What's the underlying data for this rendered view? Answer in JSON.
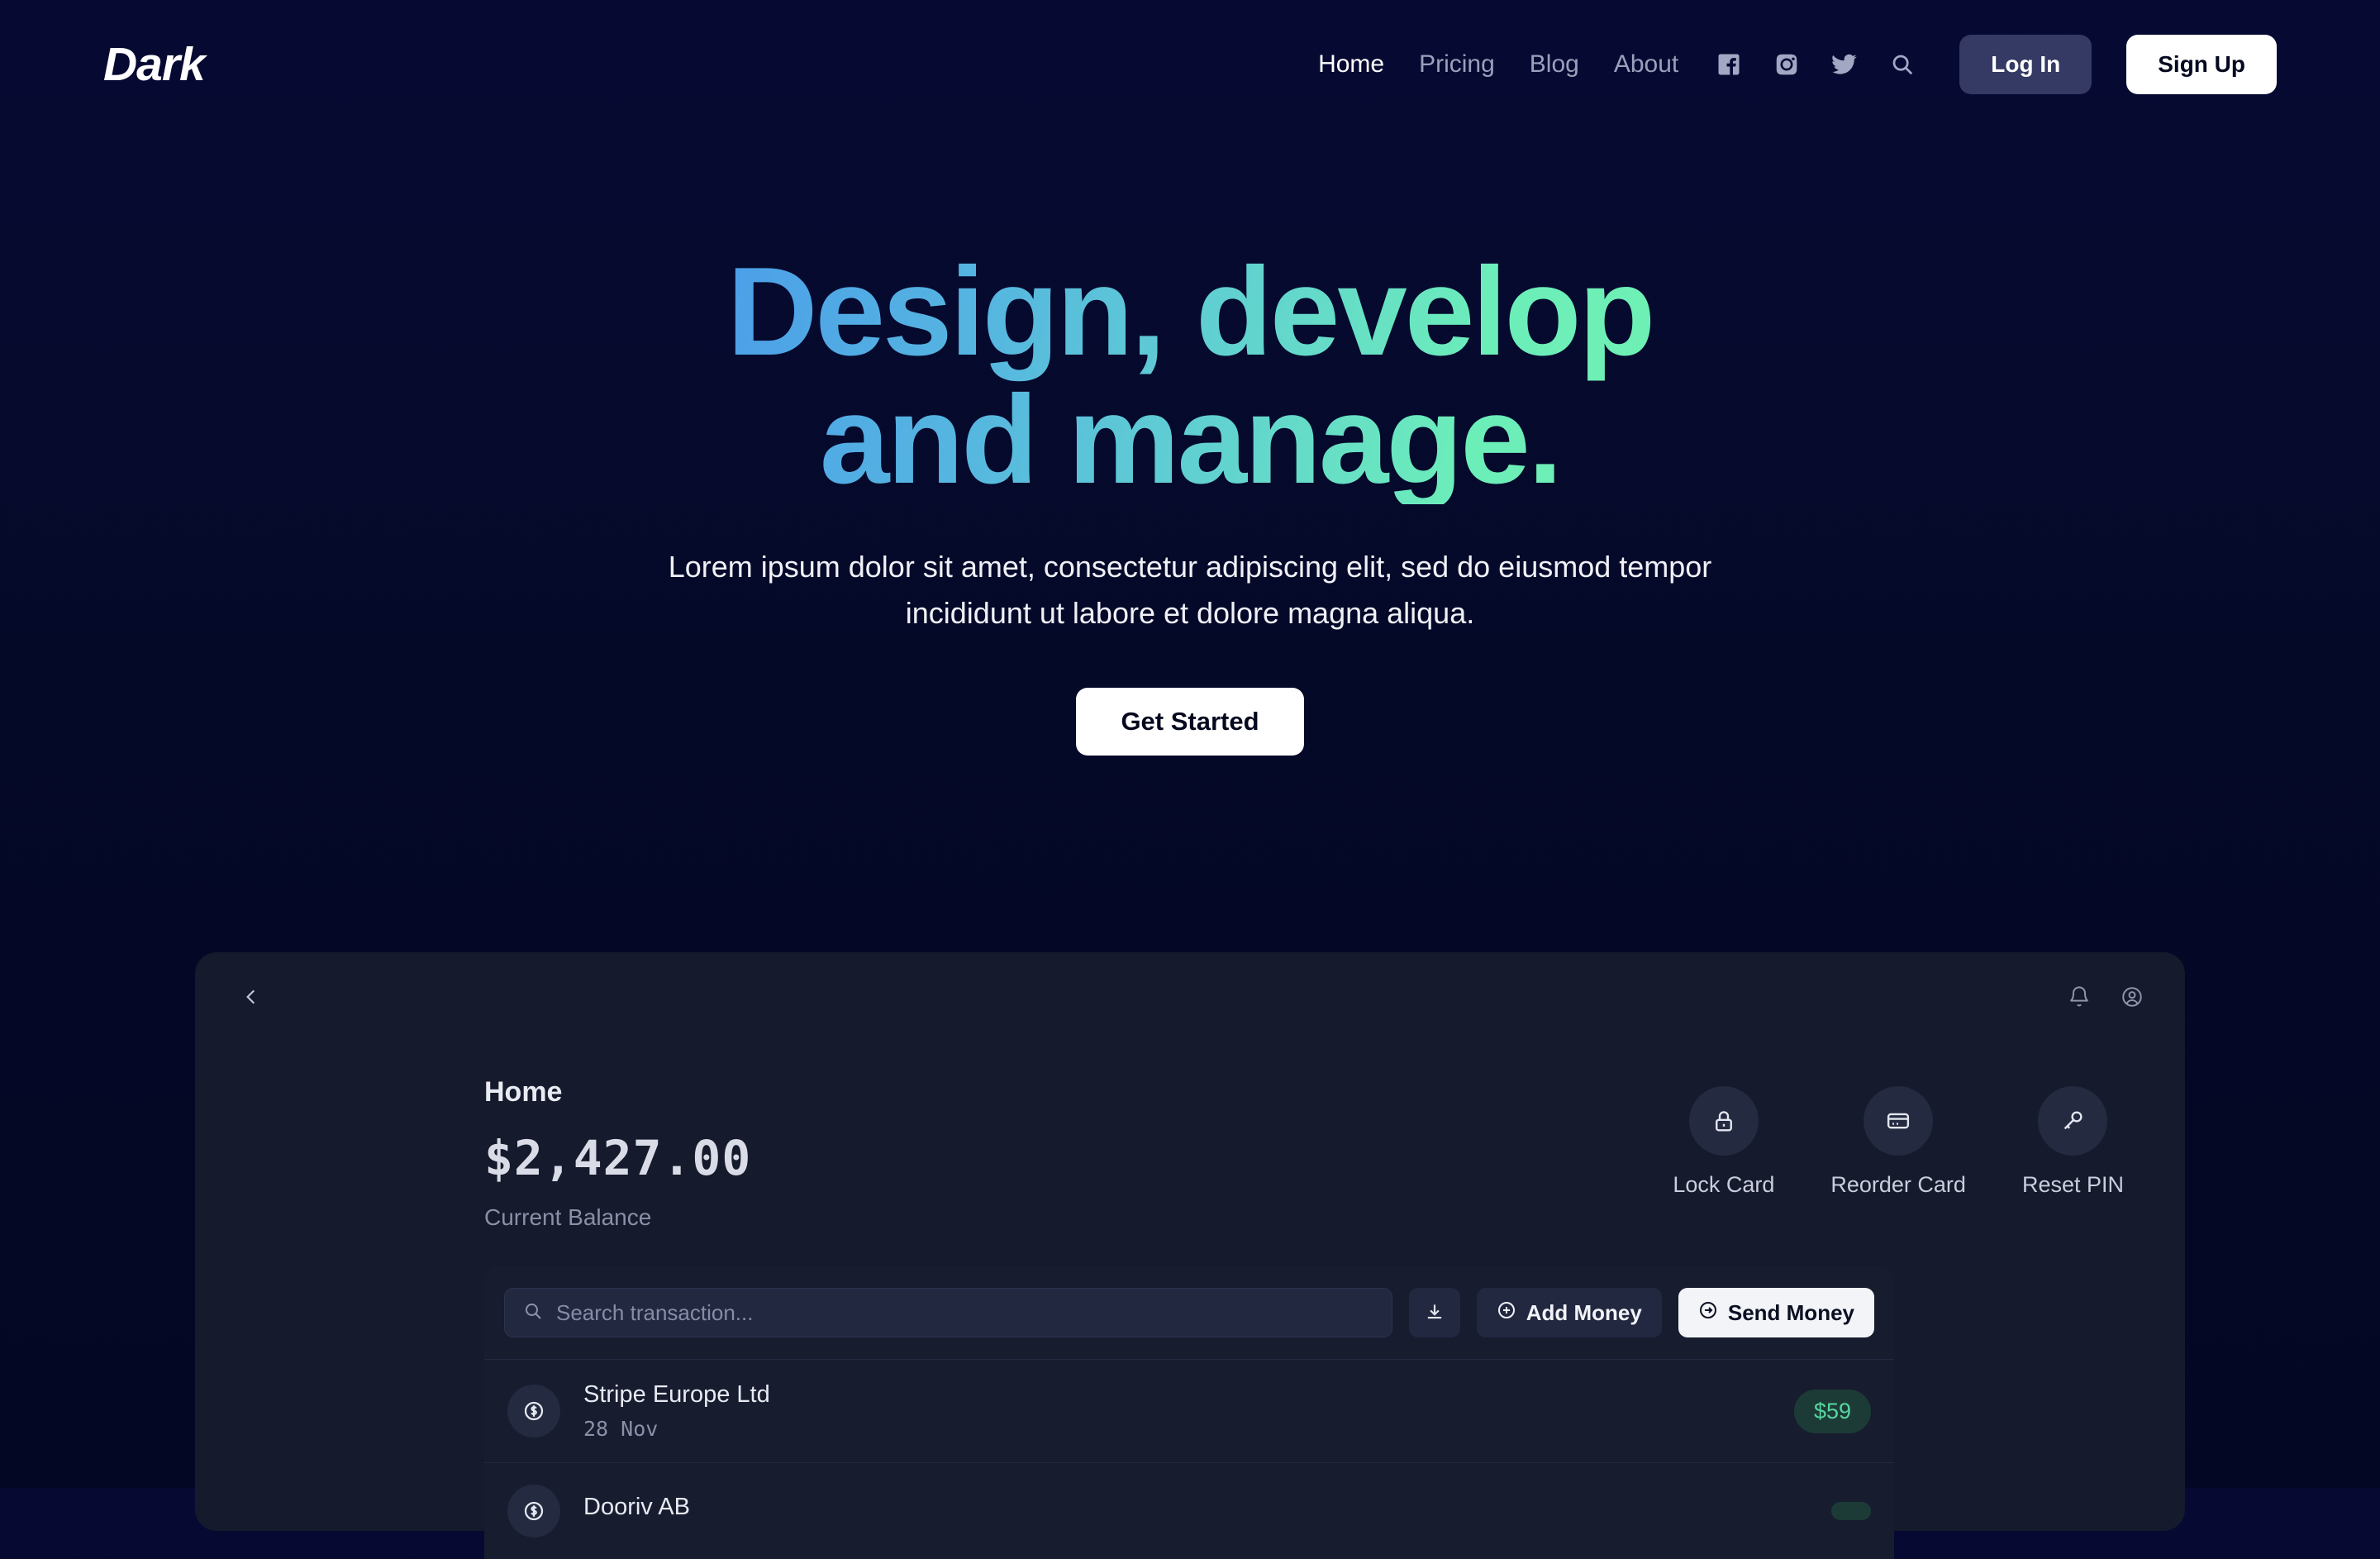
{
  "navbar": {
    "logo": "Dark",
    "links": [
      {
        "label": "Home",
        "active": true
      },
      {
        "label": "Pricing",
        "active": false
      },
      {
        "label": "Blog",
        "active": false
      },
      {
        "label": "About",
        "active": false
      }
    ],
    "icons": [
      "facebook-icon",
      "instagram-icon",
      "twitter-icon",
      "search-icon"
    ],
    "login_label": "Log In",
    "signup_label": "Sign Up"
  },
  "hero": {
    "title_line1": "Design, develop",
    "title_line2": "and manage.",
    "subtitle": "Lorem ipsum dolor sit amet, consectetur adipiscing elit, sed do eiusmod tempor incididunt ut labore et dolore magna aliqua.",
    "cta_label": "Get Started",
    "gradient_start": "#4c9fe8",
    "gradient_end": "#6ff0b4"
  },
  "dashboard": {
    "back_icon": "chevron-left-icon",
    "notification_icon": "bell-icon",
    "account_icon": "user-circle-icon",
    "page_title": "Home",
    "balance": "$2,427.00",
    "balance_label": "Current Balance",
    "card_actions": [
      {
        "label": "Lock Card",
        "icon": "lock-icon"
      },
      {
        "label": "Reorder Card",
        "icon": "credit-card-icon"
      },
      {
        "label": "Reset PIN",
        "icon": "key-icon"
      }
    ],
    "toolbar": {
      "search_placeholder": "Search transaction...",
      "search_value": "",
      "download_icon": "download-icon",
      "add_money_label": "Add Money",
      "send_money_label": "Send Money"
    },
    "transactions": [
      {
        "name": "Stripe Europe Ltd",
        "date": "28 Nov",
        "amount": "$59",
        "icon": "dollar-circle-icon"
      },
      {
        "name": "Dooriv AB",
        "date": "",
        "amount": "",
        "icon": "dollar-circle-icon"
      }
    ],
    "amount_color": "#56d6a0"
  }
}
